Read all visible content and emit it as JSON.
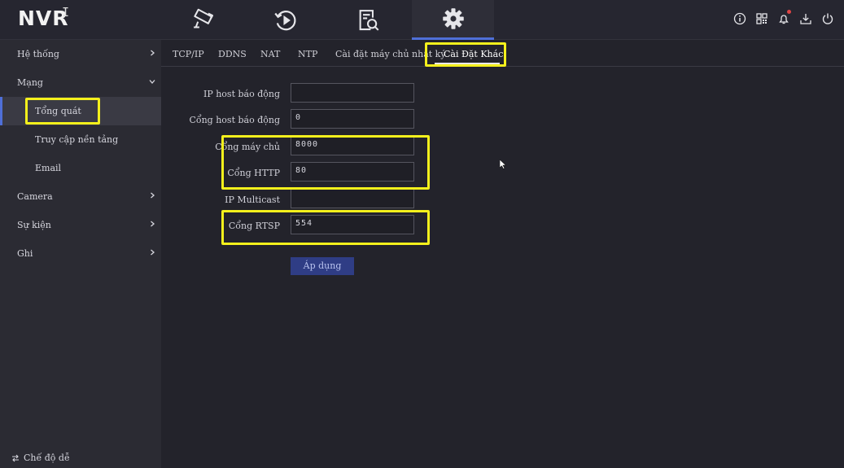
{
  "app": {
    "logo": "NVR",
    "cursor_glyph": "I"
  },
  "topnav": {
    "tabs": [
      {
        "icon": "camera-icon"
      },
      {
        "icon": "playback-icon"
      },
      {
        "icon": "search-file-icon"
      },
      {
        "icon": "gear-icon",
        "active": true
      }
    ],
    "right_icons": [
      "info-icon",
      "qr-code-icon",
      "bell-icon",
      "download-icon",
      "power-icon"
    ]
  },
  "sidebar": {
    "items": [
      {
        "label": "Hệ thống",
        "level": 1,
        "chevron": "right"
      },
      {
        "label": "Mạng",
        "level": 1,
        "chevron": "down"
      },
      {
        "label": "Tổng quát",
        "level": 2,
        "active": true
      },
      {
        "label": "Truy cập nền tảng",
        "level": 2
      },
      {
        "label": "Email",
        "level": 2
      },
      {
        "label": "Camera",
        "level": 1,
        "chevron": "right"
      },
      {
        "label": "Sự kiện",
        "level": 1,
        "chevron": "right"
      },
      {
        "label": "Ghi",
        "level": 1,
        "chevron": "right"
      }
    ],
    "bottom_label": "Chế độ dễ"
  },
  "tabs": [
    "TCP/IP",
    "DDNS",
    "NAT",
    "NTP",
    "Cài đặt máy chủ nhật ký",
    "Cài Đặt Khác"
  ],
  "active_tab": "Cài Đặt Khác",
  "form": {
    "fields": [
      {
        "label": "IP host báo động",
        "value": ""
      },
      {
        "label": "Cổng host báo động",
        "value": "0"
      },
      {
        "label": "Cổng máy chủ",
        "value": "8000"
      },
      {
        "label": "Cổng HTTP",
        "value": "80"
      },
      {
        "label": "IP Multicast",
        "value": ""
      },
      {
        "label": "Cổng RTSP",
        "value": "554"
      }
    ],
    "apply_label": "Áp dụng"
  },
  "colors": {
    "background": "#23232b",
    "sidebar": "#2b2b33",
    "accent": "#4f6fd8",
    "button": "#2f3d85",
    "highlight": "#f4f01c"
  }
}
